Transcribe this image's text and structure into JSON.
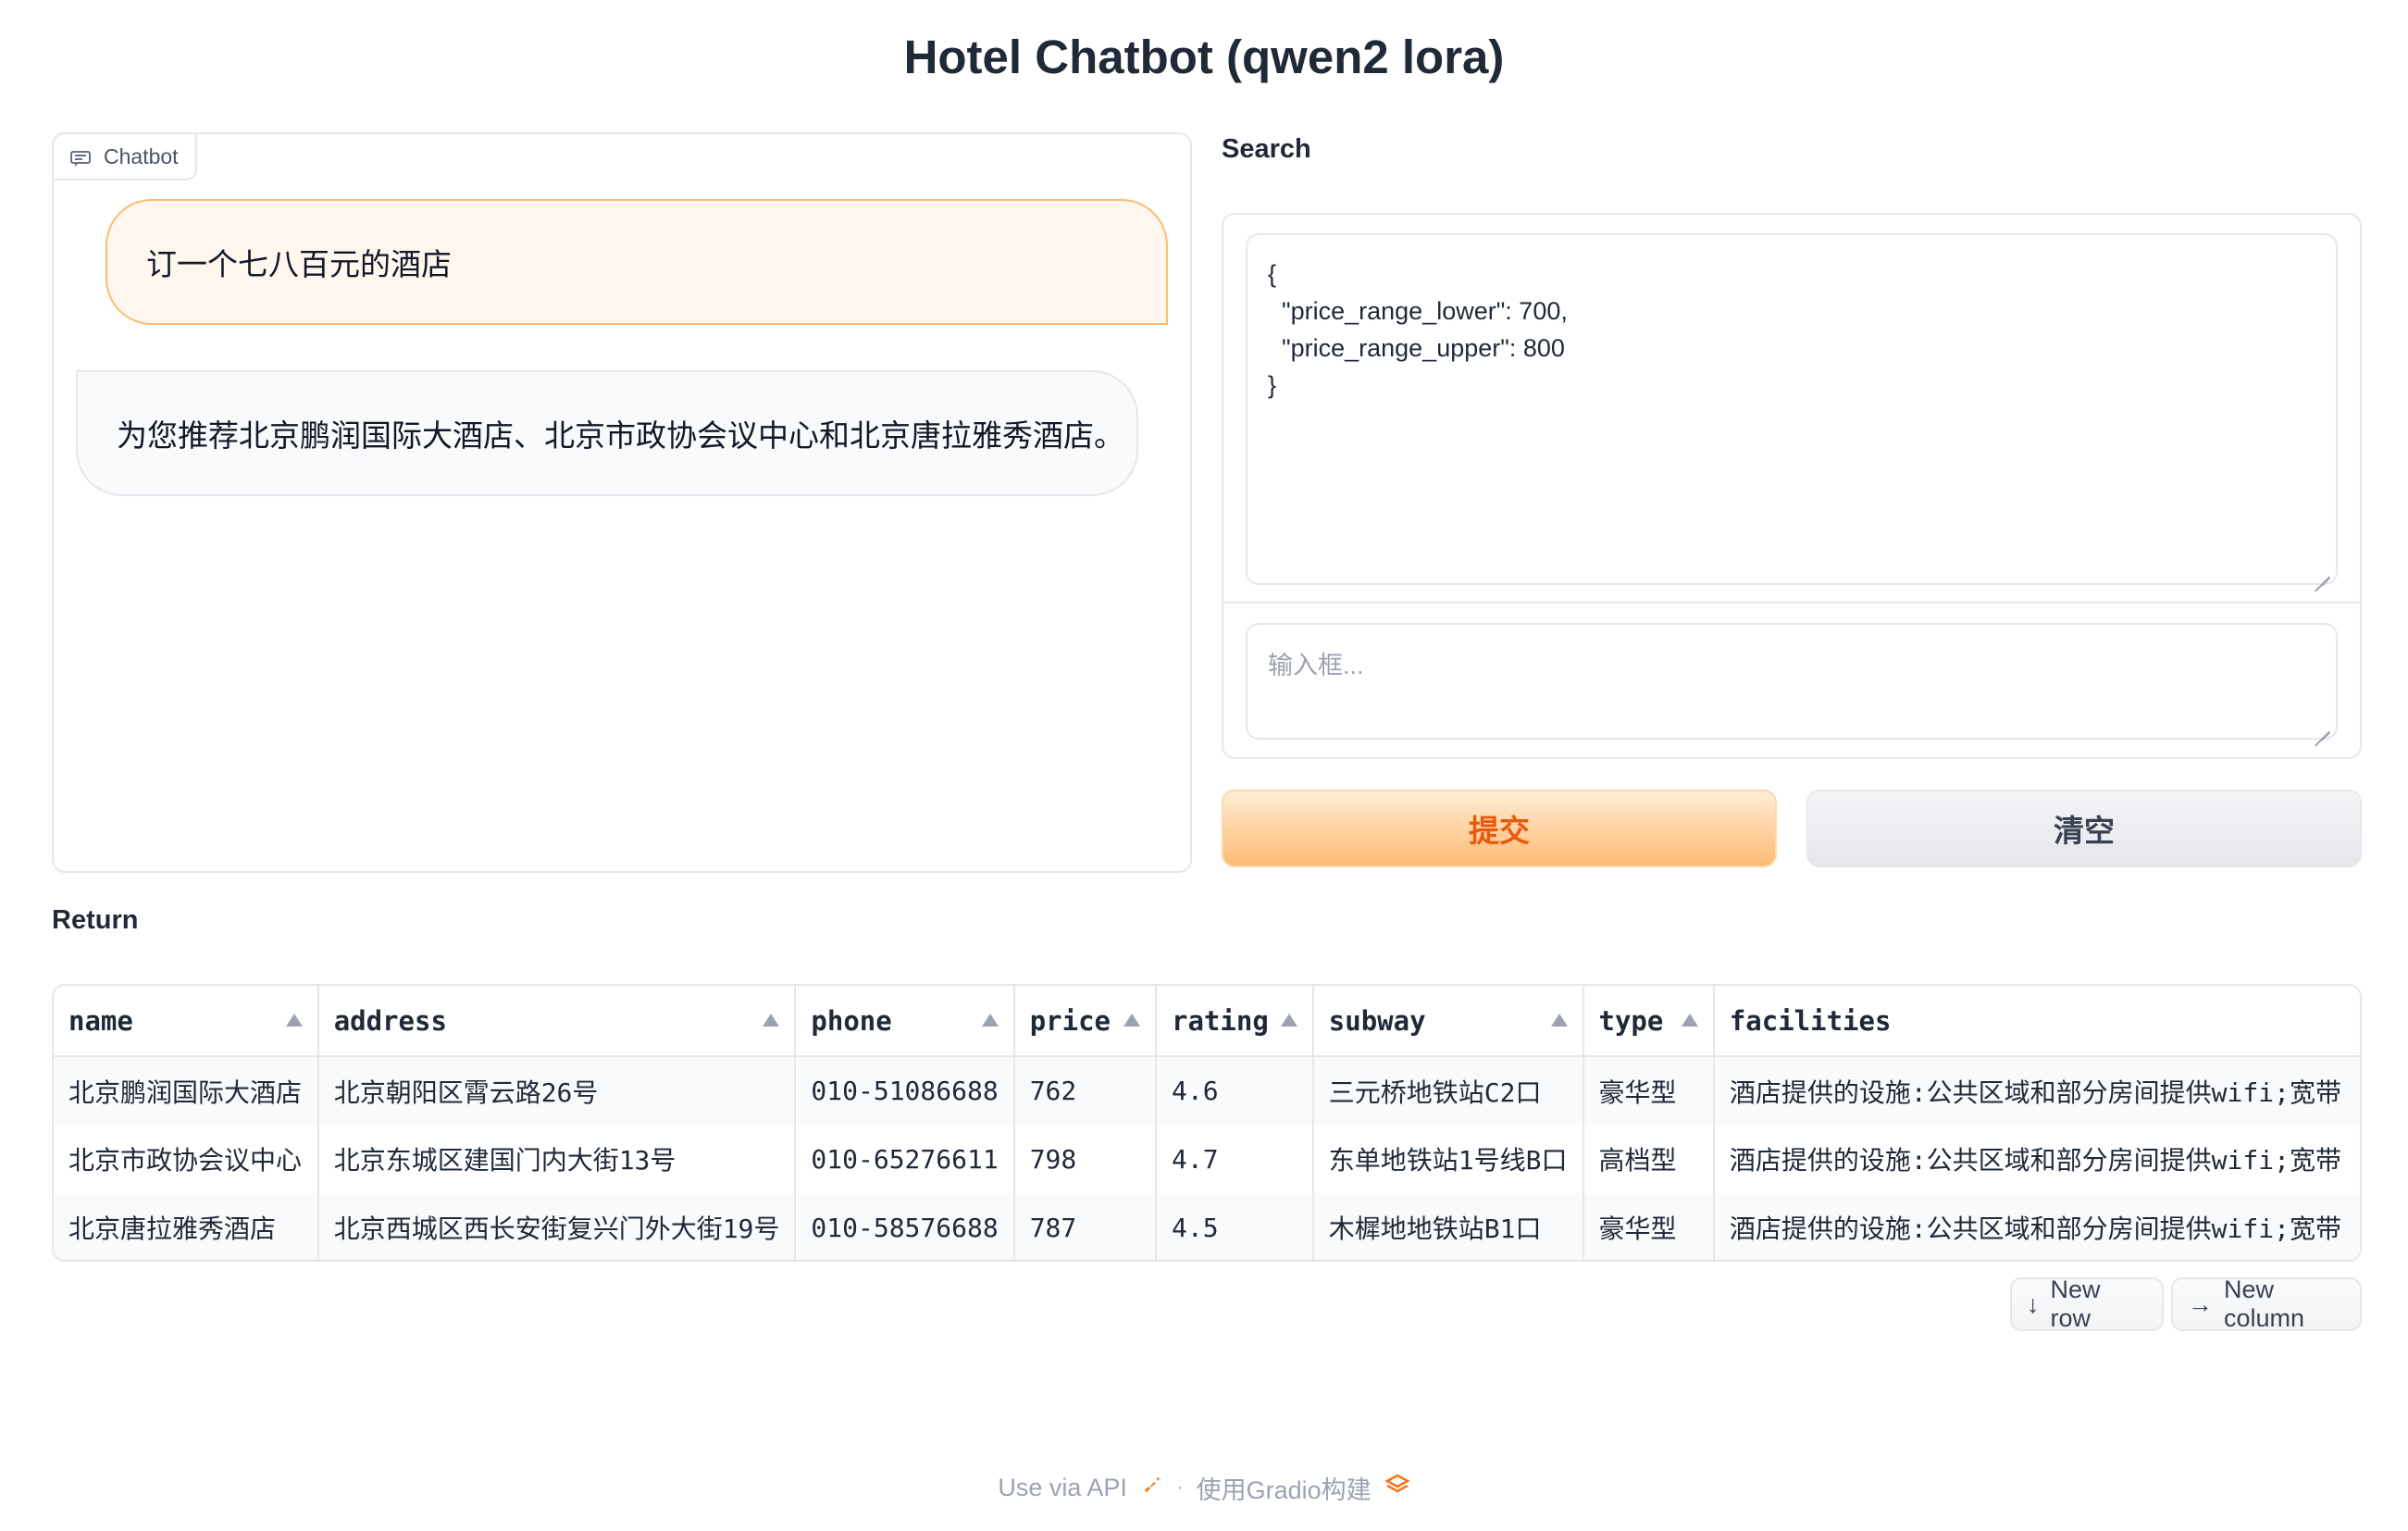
{
  "app": {
    "title": "Hotel Chatbot (qwen2 lora)"
  },
  "chatbot": {
    "label": "Chatbot",
    "icon": "chat-icon",
    "messages": [
      {
        "role": "user",
        "text": "订一个七八百元的酒店"
      },
      {
        "role": "bot",
        "text": "为您推荐北京鹏润国际大酒店、北京市政协会议中心和北京唐拉雅秀酒店。"
      }
    ]
  },
  "search": {
    "label": "Search",
    "json_value": "{\n  \"price_range_lower\": 700,\n  \"price_range_upper\": 800\n}",
    "input_placeholder": "输入框...",
    "input_value": ""
  },
  "buttons": {
    "submit": "提交",
    "clear": "清空"
  },
  "return": {
    "label": "Return",
    "columns": [
      "name",
      "address",
      "phone",
      "price",
      "rating",
      "subway",
      "type",
      "facilities"
    ],
    "rows": [
      [
        "北京鹏润国际大酒店",
        "北京朝阳区霄云路26号",
        "010-51086688",
        "762",
        "4.6",
        "三元桥地铁站C2口",
        "豪华型",
        "酒店提供的设施:公共区域和部分房间提供wifi;宽带"
      ],
      [
        "北京市政协会议中心",
        "北京东城区建国门内大街13号",
        "010-65276611",
        "798",
        "4.7",
        "东单地铁站1号线B口",
        "高档型",
        "酒店提供的设施:公共区域和部分房间提供wifi;宽带"
      ],
      [
        "北京唐拉雅秀酒店",
        "北京西城区西长安街复兴门外大街19号",
        "010-58576688",
        "787",
        "4.5",
        "木樨地地铁站B1口",
        "豪华型",
        "酒店提供的设施:公共区域和部分房间提供wifi;宽带"
      ]
    ],
    "new_row": "New row",
    "new_column": "New column"
  },
  "footer": {
    "api": "Use via API",
    "separator": "·",
    "built_with": "使用Gradio构建"
  },
  "colors": {
    "accent": "#ea580c",
    "accent_light": "#fdba74",
    "border": "#e5e7eb"
  }
}
